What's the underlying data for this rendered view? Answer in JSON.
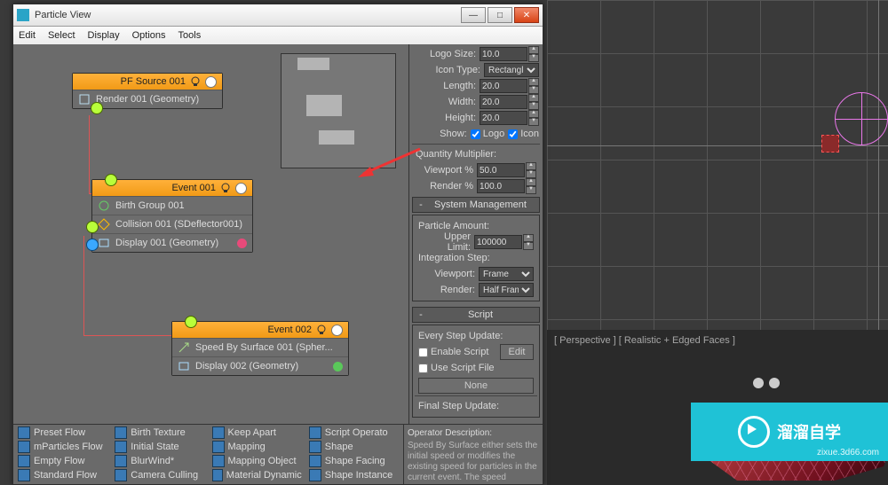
{
  "window": {
    "title": "Particle View",
    "menu": [
      "Edit",
      "Select",
      "Display",
      "Options",
      "Tools"
    ]
  },
  "nodes": {
    "source": {
      "title": "PF Source 001",
      "rows": [
        {
          "label": "Render 001 (Geometry)"
        }
      ]
    },
    "event1": {
      "title": "Event 001",
      "rows": [
        {
          "label": "Birth Group 001"
        },
        {
          "label": "Collision 001 (SDeflector001)"
        },
        {
          "label": "Display 001 (Geometry)",
          "dot": "red"
        }
      ]
    },
    "event2": {
      "title": "Event 002",
      "rows": [
        {
          "label": "Speed By Surface 001 (Spher..."
        },
        {
          "label": "Display 002 (Geometry)",
          "dot": "green"
        }
      ]
    }
  },
  "params": {
    "logoSize": {
      "label": "Logo Size:",
      "value": "10.0"
    },
    "iconType": {
      "label": "Icon Type:",
      "value": "Rectangle"
    },
    "length": {
      "label": "Length:",
      "value": "20.0"
    },
    "width": {
      "label": "Width:",
      "value": "20.0"
    },
    "height": {
      "label": "Height:",
      "value": "20.0"
    },
    "show": {
      "label": "Show:",
      "logo": "Logo",
      "icon": "Icon"
    },
    "qm": {
      "title": "Quantity Multiplier:",
      "viewport": {
        "label": "Viewport %",
        "value": "50.0"
      },
      "render": {
        "label": "Render %",
        "value": "100.0"
      }
    },
    "sysMgmt": {
      "title": "System Management",
      "pa": "Particle Amount:",
      "ul": {
        "label": "Upper Limit:",
        "value": "100000"
      },
      "is": "Integration Step:",
      "vp": {
        "label": "Viewport:",
        "value": "Frame"
      },
      "rn": {
        "label": "Render:",
        "value": "Half Frame"
      }
    },
    "script": {
      "title": "Script",
      "esu": "Every Step Update:",
      "enable": "Enable Script",
      "edit": "Edit",
      "usf": "Use Script File",
      "none": "None",
      "fsu": "Final Step Update:"
    }
  },
  "depot": {
    "items": [
      "Preset Flow",
      "Birth Texture",
      "Keep Apart",
      "Script Operato",
      "mParticles Flow",
      "Initial State",
      "Mapping",
      "Shape",
      "Empty Flow",
      "BlurWind*",
      "Mapping Object",
      "Shape Facing",
      "Standard Flow",
      "Camera Culling",
      "Material Dynamic",
      "Shape Instance"
    ],
    "desc": {
      "title": "Operator Description:",
      "body": "Speed By Surface either sets the initial speed or modifies the existing speed for particles in the current event.  The speed"
    }
  },
  "viewport": {
    "label": "[ Perspective ] [ Realistic + Edged Faces ]"
  },
  "watermark": {
    "text": "溜溜自学",
    "sub": "zixue.3d66.com"
  }
}
